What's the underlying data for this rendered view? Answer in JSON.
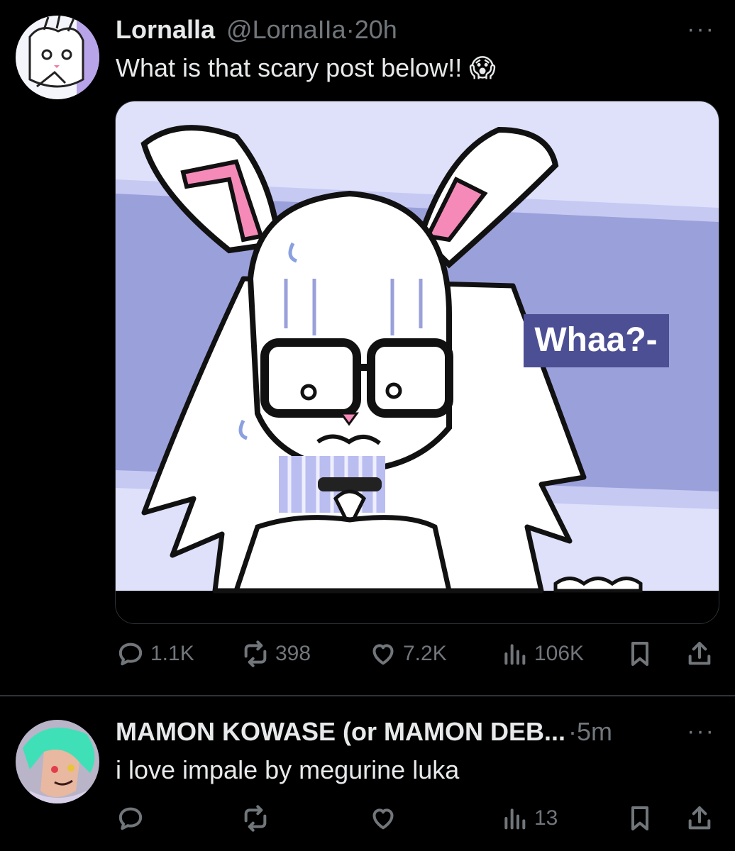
{
  "posts": [
    {
      "author_name": "Lornalla",
      "author_handle": "@LornaIIa",
      "separator": "·",
      "time": "20h",
      "text": "What is that scary post below!!",
      "emoji": "😱",
      "more": "···",
      "media_caption": "Whaa?-",
      "stats": {
        "replies": "1.1K",
        "reposts": "398",
        "likes": "7.2K",
        "views": "106K"
      }
    },
    {
      "author_name": "MAMON KOWASE (or MAMON DEB...",
      "separator": "·",
      "time": "5m",
      "text": "i love impale by megurine luka",
      "more": "···",
      "stats": {
        "replies": "",
        "reposts": "",
        "likes": "",
        "views": "13"
      }
    }
  ],
  "icons": [
    "reply-icon",
    "repost-icon",
    "like-icon",
    "views-icon",
    "bookmark-icon",
    "share-icon"
  ],
  "colors": {
    "background": "#000000",
    "text": "#e7e9ea",
    "muted": "#71767b",
    "divider": "#2f3336"
  }
}
